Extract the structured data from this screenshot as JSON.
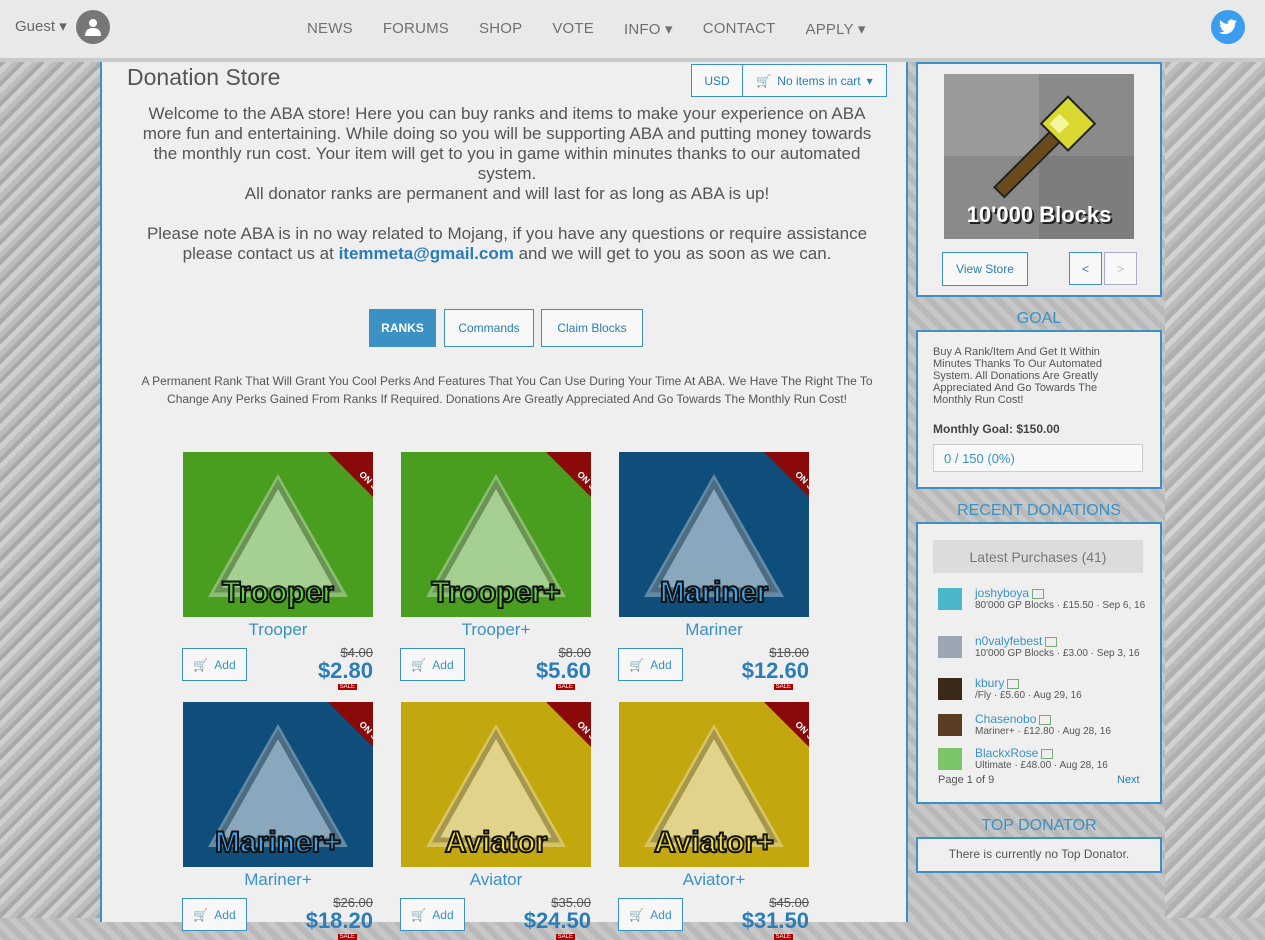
{
  "nav": {
    "guest_label": "Guest",
    "links": [
      "NEWS",
      "FORUMS",
      "SHOP",
      "VOTE",
      "INFO",
      "CONTACT",
      "APPLY"
    ]
  },
  "store": {
    "title": "Donation Store",
    "currency": "USD",
    "cart": "No items in cart",
    "intro1": "Welcome to the ABA store! Here you can buy ranks and items to make your experience on ABA more fun and entertaining. While doing so you will be supporting ABA and putting money towards the monthly run cost. Your item will get to you in game within minutes thanks to our automated system.",
    "intro2": "All donator ranks are permanent and will last for as long as ABA is up!",
    "intro3a": "Please note ABA is in no way related to Mojang, if you have any questions or require assistance please contact us at",
    "email": "itemmeta@gmail.com",
    "intro3b": "and we will get to you as soon as we can.",
    "tabs": [
      "RANKS",
      "Commands",
      "Claim Blocks"
    ],
    "description": "A Permanent Rank That Will Grant You Cool Perks And Features That You Can Use During Your Time At ABA. We Have The Right The To Change Any Perks Gained From Ranks If Required. Donations Are Greatly Appreciated And Go Towards The Monthly Run Cost!",
    "add_label": "Add",
    "on_sale": "ON SALE",
    "sale_tag": "SALE",
    "products": [
      {
        "name": "Trooper",
        "old": "$4.00",
        "new": "$2.80",
        "color": "#4a9e1f"
      },
      {
        "name": "Trooper+",
        "old": "$8.00",
        "new": "$5.60",
        "color": "#4a9e1f"
      },
      {
        "name": "Mariner",
        "old": "$18.00",
        "new": "$12.60",
        "color": "#0f4d7a"
      },
      {
        "name": "Mariner+",
        "old": "$26.00",
        "new": "$18.20",
        "color": "#0f4d7a"
      },
      {
        "name": "Aviator",
        "old": "$35.00",
        "new": "$24.50",
        "color": "#c3a70f"
      },
      {
        "name": "Aviator+",
        "old": "$45.00",
        "new": "$31.50",
        "color": "#c3a70f"
      }
    ]
  },
  "sidebar": {
    "featured_caption": "10'000 Blocks",
    "view_store": "View Store",
    "prev": "<",
    "next": ">",
    "goal_title": "GOAL",
    "goal_text": "Buy A Rank/Item And Get It Within Minutes Thanks To Our Automated System. All Donations Are Greatly Appreciated And Go Towards The Monthly Run Cost!",
    "goal_amount": "Monthly Goal: $150.00",
    "goal_progress": "0 / 150 (0%)",
    "recent_title": "RECENT DONATIONS",
    "latest_label": "Latest Purchases (41)",
    "donations": [
      {
        "user": "joshyboya",
        "info": "80'000 GP Blocks · £15.50 · Sep 6, 16"
      },
      {
        "user": "n0valyfebest",
        "info": "10'000 GP Blocks · £3.00 · Sep 3, 16"
      },
      {
        "user": "kbury",
        "info": "/Fly · £5.60 · Aug 29, 16"
      },
      {
        "user": "Chasenobo",
        "info": "Mariner+ · £12.80 · Aug 28, 16"
      },
      {
        "user": "BlackxRose",
        "info": "Ultimate · £48.00 · Aug 28, 16"
      }
    ],
    "pager": "Page 1 of 9",
    "pager_next": "Next",
    "top_title": "TOP DONATOR",
    "top_text": "There is currently no Top Donator."
  }
}
